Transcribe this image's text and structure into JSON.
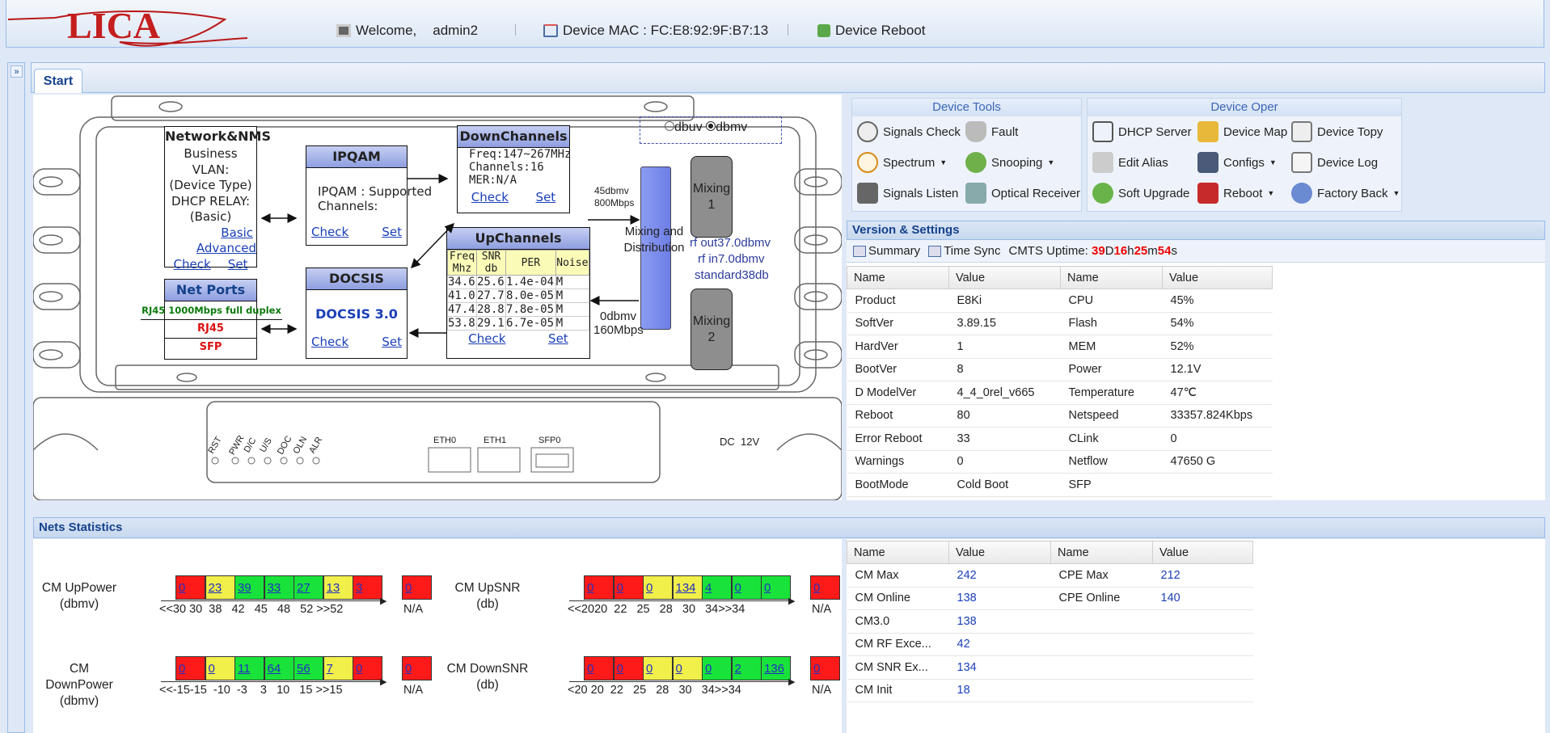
{
  "header": {
    "logo": "LICA",
    "welcome_label": "Welcome,",
    "username": "admin2",
    "mac_label": "Device MAC : FC:E8:92:9F:B7:13",
    "reboot_label": "Device Reboot"
  },
  "tabs": [
    {
      "label": "Start"
    }
  ],
  "device": {
    "unit_options": [
      "dbuv",
      "dbmv"
    ],
    "unit_selected": "dbmv",
    "network": {
      "title": "Network&NMS",
      "line1": "Business VLAN:",
      "line2": "(Device Type)",
      "line3": "DHCP RELAY:",
      "line4": "(Basic)",
      "basic_link": "Basic",
      "advanced_link": "Advanced",
      "check": "Check",
      "set": "Set"
    },
    "ipqam": {
      "title": "IPQAM",
      "line1": "IPQAM : Supported",
      "line2": "Channels:",
      "check": "Check",
      "set": "Set"
    },
    "downchannels": {
      "title": "DownChannels",
      "freq": "Freq:147~267MHz",
      "channels": "Channels:16",
      "mer": "MER:N/A",
      "check": "Check",
      "set": "Set"
    },
    "upchannels": {
      "title": "UpChannels",
      "headers": [
        "Freq Mhz",
        "SNR db",
        "PER",
        "Noise"
      ],
      "rows": [
        [
          "34.6",
          "25.6",
          "1.4e-04",
          "M"
        ],
        [
          "41.0",
          "27.7",
          "8.0e-05",
          "M"
        ],
        [
          "47.4",
          "28.8",
          "7.8e-05",
          "M"
        ],
        [
          "53.8",
          "29.1",
          "6.7e-05",
          "M"
        ]
      ],
      "check": "Check",
      "set": "Set"
    },
    "docsis": {
      "title": "DOCSIS",
      "version": "DOCSIS 3.0",
      "check": "Check",
      "set": "Set"
    },
    "netports": {
      "title": "Net Ports",
      "rj45_speed": "RJ45 1000Mbps full duplex",
      "rj45": "RJ45",
      "sfp": "SFP"
    },
    "mixing_dist": "Mixing and Distribution",
    "mixing1": "Mixing 1",
    "mixing2": "Mixing 2",
    "down_level": "45dbmv",
    "down_rate": "800Mbps",
    "up_level": "0dbmv",
    "up_rate": "160Mbps",
    "rf_out": "rf out37.0dbmv",
    "rf_in": "rf in7.0dbmv",
    "standard": "standard38db",
    "leds": [
      "RST",
      "PWR",
      "D/C",
      "U/S",
      "DOC",
      "OLN",
      "ALR"
    ],
    "ports": [
      "ETH0",
      "ETH1",
      "SFP0"
    ],
    "dc": "DC  12V"
  },
  "device_tools": {
    "title": "Device Tools",
    "items": [
      "Signals Check",
      "Fault",
      "Spectrum",
      "Snooping",
      "Signals Listen",
      "Optical Receiver"
    ]
  },
  "device_oper": {
    "title": "Device Oper",
    "items": [
      "DHCP Server",
      "Device Map",
      "Device Topy",
      "Edit Alias",
      "Configs",
      "Device Log",
      "Soft Upgrade",
      "Reboot",
      "Factory Back"
    ]
  },
  "version": {
    "title": "Version & Settings",
    "summary": "Summary",
    "time_sync": "Time Sync",
    "uptime_label": "CMTS Uptime:",
    "uptime": {
      "d": "39",
      "h": "16",
      "m": "25",
      "s": "54"
    },
    "uptime_units": {
      "d": "D",
      "h": "h",
      "m": "m",
      "s": "s"
    },
    "columns": [
      "Name",
      "Value",
      "Name",
      "Value"
    ],
    "rows": [
      [
        "Product",
        "E8Ki",
        "CPU",
        "45%"
      ],
      [
        "SoftVer",
        "3.89.15",
        "Flash",
        "54%"
      ],
      [
        "HardVer",
        "1",
        "MEM",
        "52%"
      ],
      [
        "BootVer",
        "8",
        "Power",
        "12.1V"
      ],
      [
        "D ModelVer",
        "4_4_0rel_v665",
        "Temperature",
        "47℃"
      ],
      [
        "Reboot",
        "80",
        "Netspeed",
        "33357.824Kbps"
      ],
      [
        "Error Reboot",
        "33",
        "CLink",
        "0"
      ],
      [
        "Warnings",
        "0",
        "Netflow",
        "47650 G"
      ],
      [
        "BootMode",
        "Cold Boot",
        "SFP",
        ""
      ]
    ]
  },
  "nets": {
    "title": "Nets Statistics",
    "charts": [
      {
        "label": "CM UpPower",
        "unit": "(dbmv)",
        "values": [
          "0",
          "23",
          "39",
          "33",
          "27",
          "13",
          "3"
        ],
        "colors": [
          "r",
          "y",
          "g",
          "g",
          "g",
          "y",
          "r"
        ],
        "na_value": "0",
        "na": "N/A",
        "ticks": "<<30 30  38   42   45   48   52 >>52"
      },
      {
        "label": "CM UpSNR",
        "unit": "(db)",
        "values": [
          "0",
          "0",
          "0",
          "134",
          "4",
          "0",
          "0"
        ],
        "colors": [
          "r",
          "r",
          "y",
          "y",
          "g",
          "g",
          "g"
        ],
        "na_value": "0",
        "na": "N/A",
        "ticks": "<<2020  22   25   28   30   34>>34"
      },
      {
        "label": "CM DownPower",
        "unit": "(dbmv)",
        "values": [
          "0",
          "0",
          "11",
          "64",
          "56",
          "7",
          "0"
        ],
        "colors": [
          "r",
          "y",
          "g",
          "g",
          "g",
          "y",
          "r"
        ],
        "na_value": "0",
        "na": "N/A",
        "ticks": "<<-15-15  -10  -3    3   10   15 >>15"
      },
      {
        "label": "CM DownSNR",
        "unit": "(db)",
        "values": [
          "0",
          "0",
          "0",
          "0",
          "0",
          "2",
          "136"
        ],
        "colors": [
          "r",
          "r",
          "y",
          "y",
          "g",
          "g",
          "g"
        ],
        "na_value": "0",
        "na": "N/A",
        "ticks": "<20 20  22   25   28   30   34>>34"
      }
    ],
    "columns": [
      "Name",
      "Value",
      "Name",
      "Value"
    ],
    "rows": [
      [
        "CM Max",
        "242",
        "CPE Max",
        "212"
      ],
      [
        "CM Online",
        "138",
        "CPE Online",
        "140"
      ],
      [
        "CM3.0",
        "138",
        "",
        ""
      ],
      [
        "CM RF Exce...",
        "42",
        "",
        ""
      ],
      [
        "CM SNR Ex...",
        "134",
        "",
        ""
      ],
      [
        "CM Init",
        "18",
        "",
        ""
      ]
    ]
  }
}
